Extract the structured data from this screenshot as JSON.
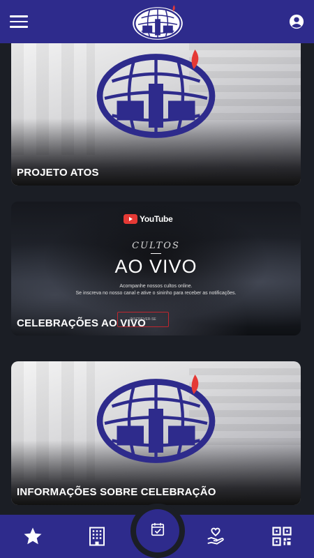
{
  "colors": {
    "brand": "#2e2b8c",
    "accent": "#e53935",
    "background": "#1b1e25"
  },
  "header": {
    "menu_icon": "hamburger-icon",
    "logo": "church-logo",
    "account_icon": "account-icon"
  },
  "cards": [
    {
      "title": "PROJETO ATOS"
    },
    {
      "title": "CELEBRAÇÕES AO VIVO",
      "banner": {
        "brand": "YouTube",
        "kicker": "CULTOS",
        "headline": "AO VIVO",
        "line1": "Acompanhe nossos cultos online.",
        "line2": "Se inscreva no nosso canal e ative o sininho para receber as notificações.",
        "button": "INSCREVER-SE"
      }
    },
    {
      "title": "INFORMAÇÕES SOBRE CELEBRAÇÃO"
    }
  ],
  "bottom_nav": [
    {
      "icon": "star-icon"
    },
    {
      "icon": "building-icon"
    },
    {
      "icon": "calendar-check-icon"
    },
    {
      "icon": "hand-heart-icon"
    },
    {
      "icon": "qr-code-icon"
    }
  ]
}
